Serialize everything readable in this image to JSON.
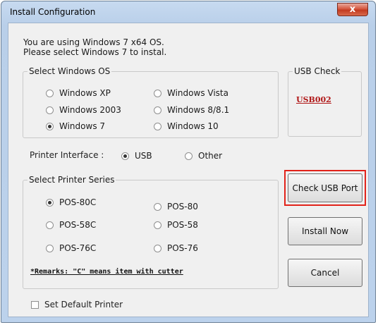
{
  "window": {
    "title": "Install Configuration",
    "close_label": "x"
  },
  "info": {
    "line1": "You are using Windows 7 x64 OS.",
    "line2": "Please select Windows 7 to instal."
  },
  "os_group": {
    "label": "Select Windows OS",
    "options": [
      {
        "label": "Windows XP",
        "selected": false
      },
      {
        "label": "Windows Vista",
        "selected": false
      },
      {
        "label": "Windows 2003",
        "selected": false
      },
      {
        "label": "Windows 8/8.1",
        "selected": false
      },
      {
        "label": "Windows 7",
        "selected": true
      },
      {
        "label": "Windows 10",
        "selected": false
      }
    ]
  },
  "usb_check": {
    "label": "USB Check",
    "status": "USB002"
  },
  "interface": {
    "label": "Printer Interface :",
    "options": [
      {
        "label": "USB",
        "selected": true
      },
      {
        "label": "Other",
        "selected": false
      }
    ]
  },
  "printer_group": {
    "label": "Select Printer Series",
    "options": [
      {
        "label": "POS-80C",
        "selected": true
      },
      {
        "label": "POS-80",
        "selected": false
      },
      {
        "label": "POS-58C",
        "selected": false
      },
      {
        "label": "POS-58",
        "selected": false
      },
      {
        "label": "POS-76C",
        "selected": false
      },
      {
        "label": "POS-76",
        "selected": false
      }
    ],
    "remarks": "*Remarks: \"C\" means item with cutter"
  },
  "buttons": {
    "check_usb": "Check USB Port",
    "install": "Install Now",
    "cancel": "Cancel"
  },
  "default_printer": {
    "label": "Set Default Printer",
    "checked": false
  },
  "colors": {
    "highlight": "#e2231a",
    "usb_status": "#b01818"
  }
}
